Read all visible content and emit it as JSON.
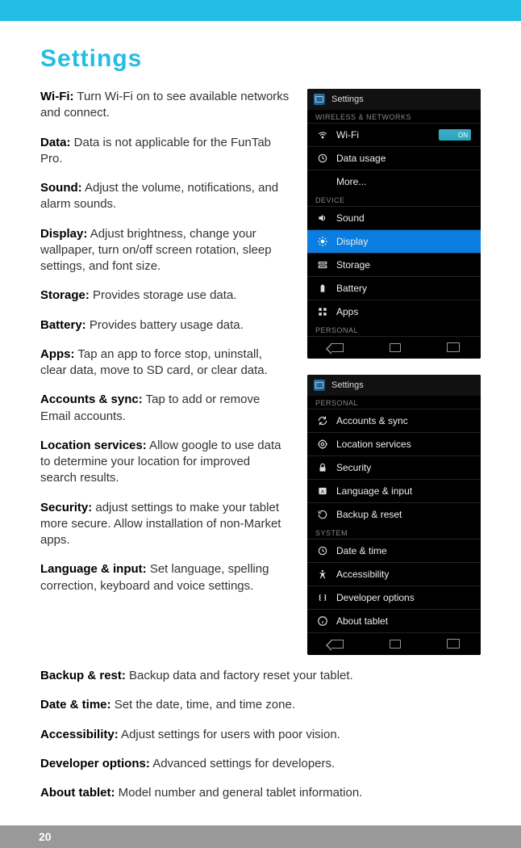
{
  "page": {
    "title": "Settings",
    "number": "20"
  },
  "definitions": [
    {
      "term": "Wi-Fi:",
      "desc": " Turn Wi-Fi on to see available networks and connect."
    },
    {
      "term": "Data:",
      "desc": " Data is not applicable for the FunTab Pro."
    },
    {
      "term": "Sound:",
      "desc": " Adjust the volume, notifications, and alarm sounds."
    },
    {
      "term": "Display:",
      "desc": " Adjust brightness, change your wallpaper, turn on/off screen rotation, sleep settings, and font size."
    },
    {
      "term": "Storage:",
      "desc": " Provides storage use data."
    },
    {
      "term": "Battery:",
      "desc": " Provides battery usage data."
    },
    {
      "term": "Apps:",
      "desc": " Tap an app to force stop, uninstall, clear data, move to SD card, or clear data."
    },
    {
      "term": "Accounts & sync:",
      "desc": " Tap to add or remove Email accounts."
    },
    {
      "term": "Location services:",
      "desc": " Allow google to use data to determine your location for improved search results."
    },
    {
      "term": "Security:",
      "desc": " adjust settings to make your tablet more secure. Allow installation of non-Market apps."
    },
    {
      "term": "Language & input:",
      "desc": " Set language, spelling correction, keyboard and voice settings."
    }
  ],
  "definitions_below": [
    {
      "term": "Backup & rest:",
      "desc": " Backup data and factory reset your tablet."
    },
    {
      "term": "Date & time:",
      "desc": " Set the date, time, and time zone."
    },
    {
      "term": "Accessibility:",
      "desc": " Adjust settings for users with poor vision."
    },
    {
      "term": "Developer options:",
      "desc": " Advanced settings for developers."
    },
    {
      "term": "About tablet:",
      "desc": " Model number and general tablet information."
    }
  ],
  "shot1": {
    "header": "Settings",
    "sect1": "WIRELESS & NETWORKS",
    "rows1": [
      {
        "icon": "wifi",
        "label": "Wi-Fi",
        "toggle": "ON"
      },
      {
        "icon": "data",
        "label": "Data usage"
      },
      {
        "icon": "",
        "label": "More..."
      }
    ],
    "sect2": "DEVICE",
    "rows2": [
      {
        "icon": "sound",
        "label": "Sound"
      },
      {
        "icon": "display",
        "label": "Display",
        "selected": true
      },
      {
        "icon": "storage",
        "label": "Storage"
      },
      {
        "icon": "battery",
        "label": "Battery"
      },
      {
        "icon": "apps",
        "label": "Apps"
      }
    ],
    "sect3": "PERSONAL"
  },
  "shot2": {
    "header": "Settings",
    "sect1": "PERSONAL",
    "rows1": [
      {
        "icon": "sync",
        "label": "Accounts & sync"
      },
      {
        "icon": "location",
        "label": "Location services"
      },
      {
        "icon": "security",
        "label": "Security"
      },
      {
        "icon": "language",
        "label": "Language & input"
      },
      {
        "icon": "backup",
        "label": "Backup & reset"
      }
    ],
    "sect2": "SYSTEM",
    "rows2": [
      {
        "icon": "date",
        "label": "Date & time"
      },
      {
        "icon": "accessibility",
        "label": "Accessibility"
      },
      {
        "icon": "dev",
        "label": "Developer options"
      },
      {
        "icon": "about",
        "label": "About tablet"
      }
    ]
  }
}
